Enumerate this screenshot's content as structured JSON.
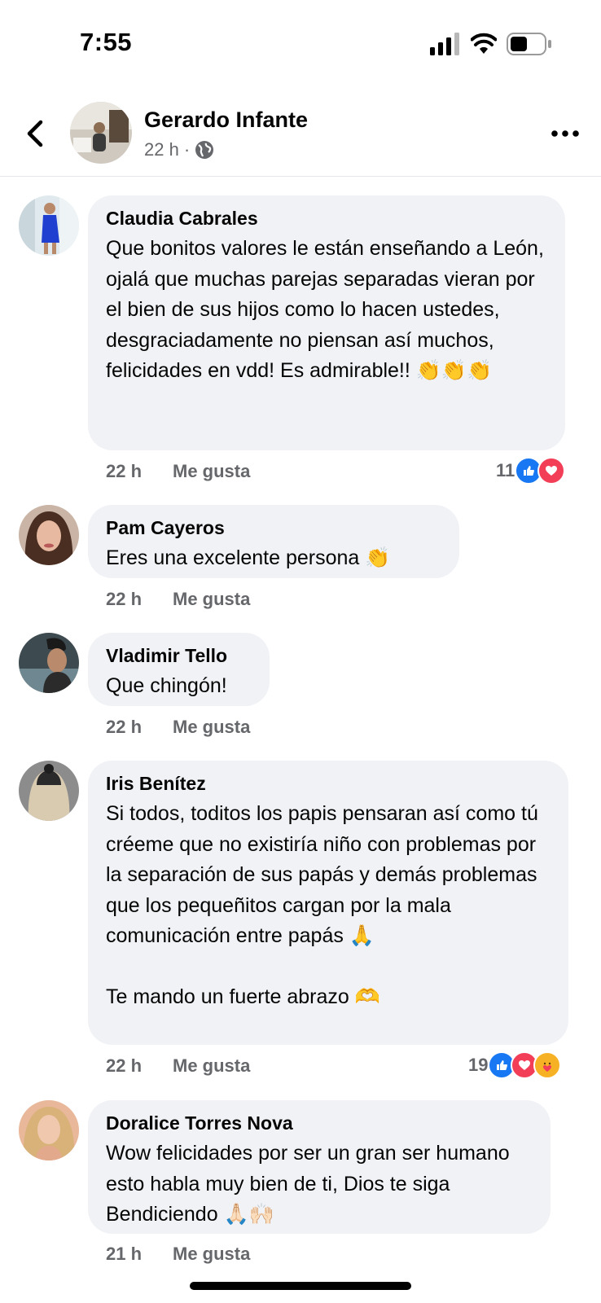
{
  "status_bar": {
    "time": "7:55"
  },
  "post": {
    "author": "Gerardo Infante",
    "time": "22 h",
    "separator": "·"
  },
  "comments": [
    {
      "name": "Claudia Cabrales",
      "text": "Que bonitos valores le están enseñando a León, ojalá que muchas parejas separadas vieran por el bien de sus hijos como lo hacen ustedes, desgraciadamente no piensan así muchos, felicidades en vdd! Es admirable!! 👏👏👏",
      "time": "22 h",
      "like": "Me gusta",
      "reaction_count": "11",
      "reactions": [
        "like-icon",
        "love-icon"
      ]
    },
    {
      "name": "Pam Cayeros",
      "text": "Eres una excelente persona 👏",
      "time": "22 h",
      "like": "Me gusta"
    },
    {
      "name": "Vladimir Tello",
      "text": "Que chingón!",
      "time": "22 h",
      "like": "Me gusta"
    },
    {
      "name": "Iris Benítez",
      "text": "Si todos, toditos los papis pensaran así como tú créeme que no existiría niño con problemas por la separación de sus papás y demás problemas que los pequeñitos cargan por la mala comunicación entre papás 🙏\n\nTe mando un fuerte abrazo 🫶",
      "time": "22 h",
      "like": "Me gusta",
      "reaction_count": "19",
      "reactions": [
        "like-icon",
        "love-icon",
        "care-icon"
      ]
    },
    {
      "name": "Doralice Torres Nova",
      "text": "Wow felicidades por ser un gran ser humano esto habla muy bien de ti, Dios te siga Bendiciendo 🙏🏻🙌🏻",
      "time": "21 h",
      "like": "Me gusta"
    }
  ],
  "colors": {
    "bubble": "#f0f2f5",
    "meta_text": "#65676b",
    "like_blue": "#1877f2",
    "love_red": "#f33e58",
    "care_yellow": "#f7b125"
  }
}
